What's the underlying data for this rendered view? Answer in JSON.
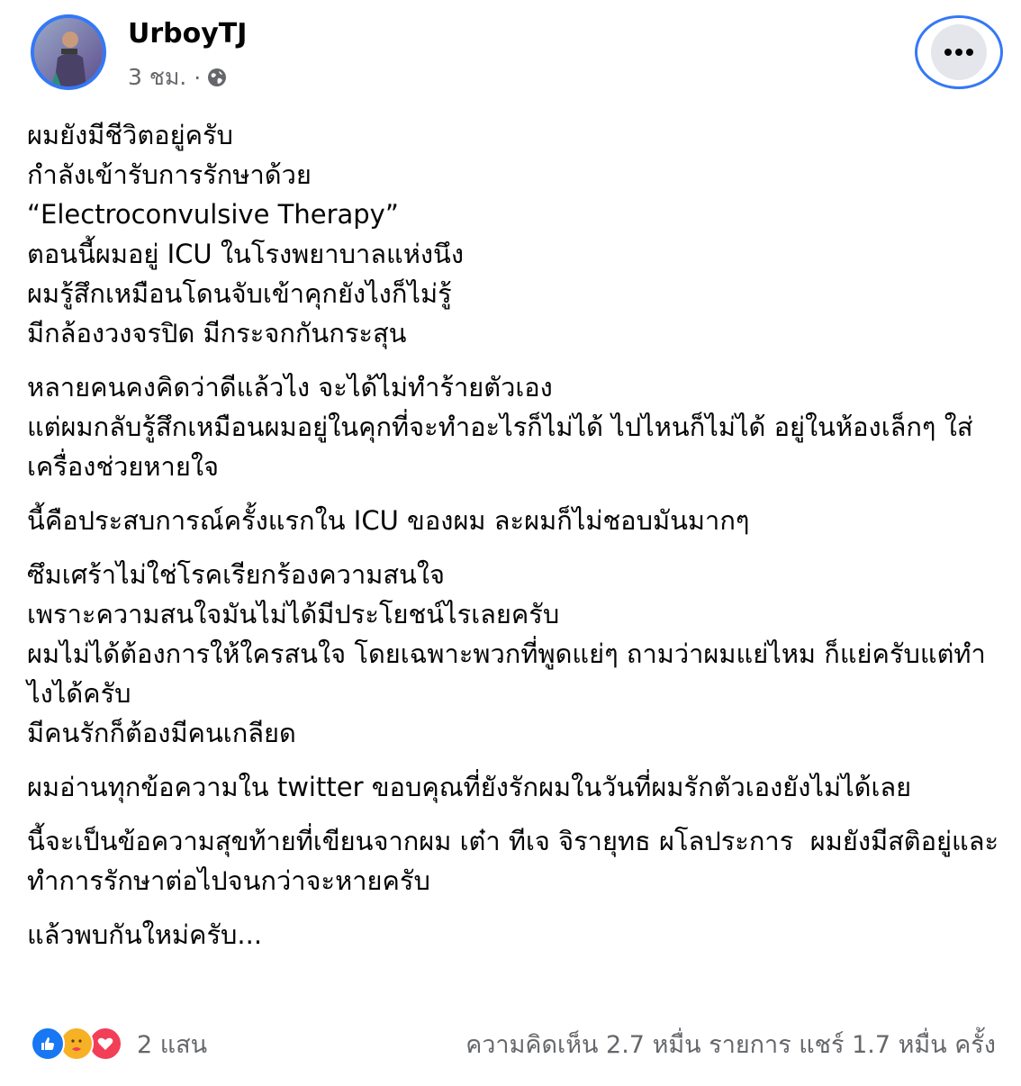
{
  "author": {
    "name": "UrboyTJ",
    "time": "3 ชม.",
    "separator": "·",
    "privacy_icon": "globe-icon"
  },
  "more_button_icon": "more-dots-icon",
  "post": {
    "paragraphs": [
      "ผมยังมีชีวิตอยู่ครับ\nกำลังเข้ารับการรักษาด้วย\n“Electroconvulsive Therapy”\nตอนนี้ผมอยู่ ICU ในโรงพยาบาลแห่งนึง\nผมรู้สึกเหมือนโดนจับเข้าคุกยังไงก็ไม่รู้\nมีกล้องวงจรปิด มีกระจกกันกระสุน",
      "หลายคนคงคิดว่าดีแล้วไง จะได้ไม่ทำร้ายตัวเอง\nแต่ผมกลับรู้สึกเหมือนผมอยู่ในคุกที่จะทำอะไรก็ไม่ได้ ไปไหนก็ไม่ได้ อยู่ในห้องเล็กๆ ใส่เครื่องช่วยหายใจ",
      "นี้คือประสบการณ์ครั้งแรกใน ICU ของผม ละผมก็ไม่ชอบมันมากๆ",
      "ซึมเศร้าไม่ใช่โรคเรียกร้องความสนใจ\nเพราะความสนใจมันไม่ได้มีประโยชน์ไรเลยครับ\nผมไม่ได้ต้องการให้ใครสนใจ โดยเฉพาะพวกที่พูดแย่ๆ ถามว่าผมแย่ไหม ก็แย่ครับแต่ทำไงได้ครับ\nมีคนรักก็ต้องมีคนเกลียด",
      "ผมอ่านทุกข้อความใน twitter ขอบคุณที่ยังรักผมในวันที่ผมรักตัวเองยังไม่ได้เลย",
      "นี้จะเป็นข้อความสุขท้ายที่เขียนจากผม เต๋า ทีเจ จิรายุทธ ผโลประการ  ผมยังมีสติอยู่และทำการรักษาต่อไปจนกว่าจะหายครับ",
      "แล้วพบกันใหม่ครับ..."
    ]
  },
  "reactions": {
    "icons": [
      "like-icon",
      "care-icon",
      "love-icon"
    ],
    "count": "2 แสน"
  },
  "stats": {
    "text": "ความคิดเห็น 2.7 หมื่น รายการ  แชร์ 1.7 หมื่น ครั้ง"
  },
  "colors": {
    "accent_blue": "#3478f6",
    "like": "#1877f2",
    "care": "#f7b125",
    "love": "#f33e58",
    "secondary_text": "#65676b"
  }
}
